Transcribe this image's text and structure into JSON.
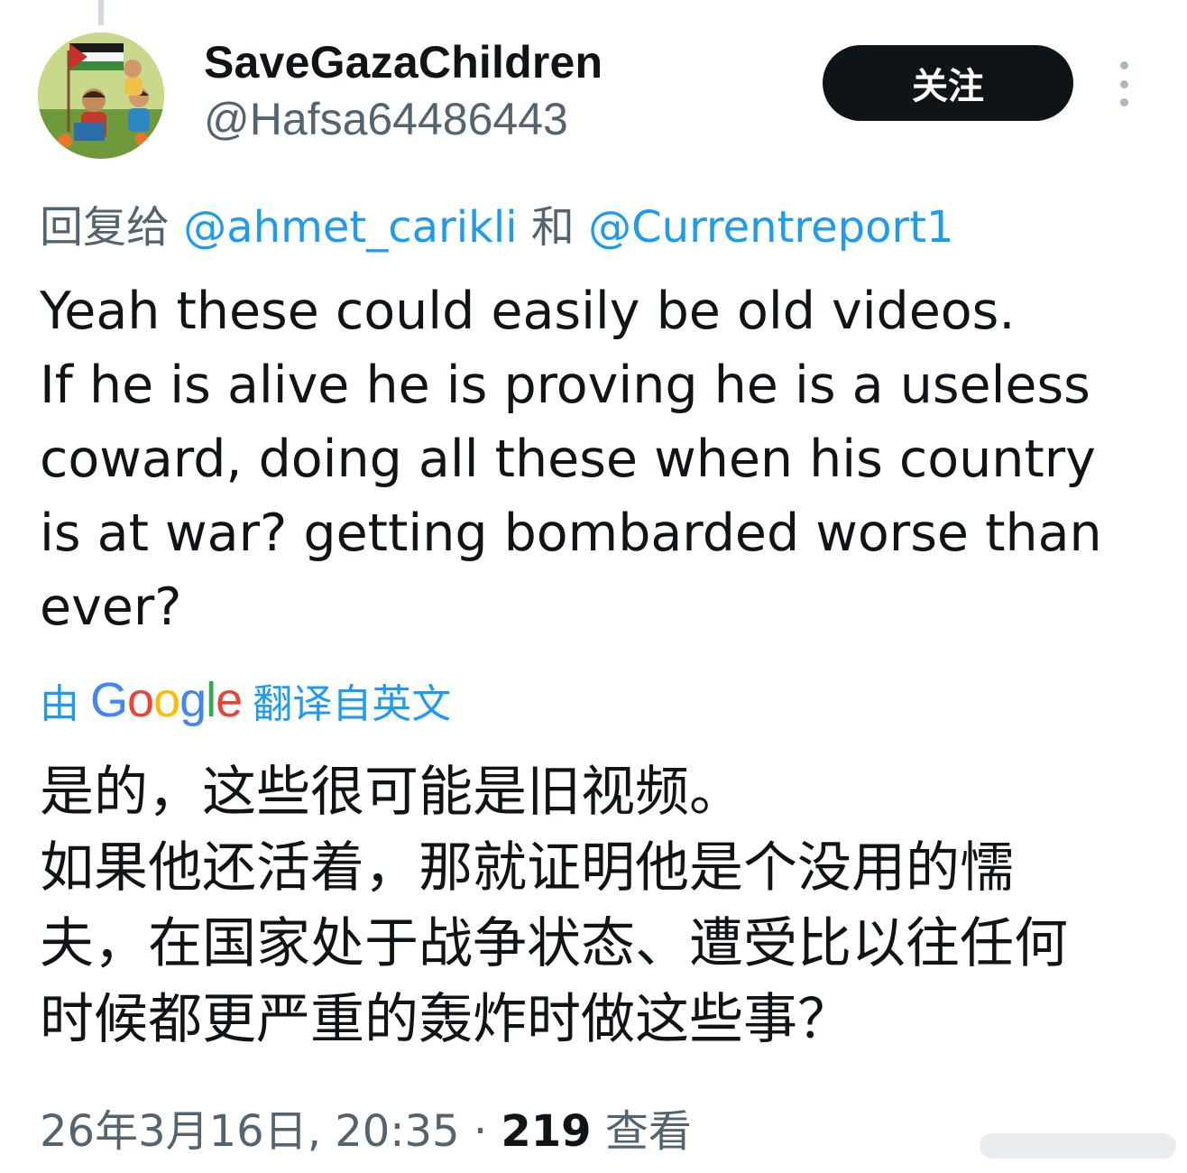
{
  "user": {
    "display_name": "SaveGazaChildren",
    "handle": "@Hafsa64486443",
    "avatar_icon": "profile-avatar-children-with-flag"
  },
  "actions": {
    "follow_label": "关注",
    "more_icon": "more-vertical-icon"
  },
  "reply": {
    "prefix": "回复给",
    "mention1": "@ahmet_carikli",
    "conjunction": "和",
    "mention2": "@Currentreport1"
  },
  "tweet": {
    "lines": [
      "Yeah these could easily be old videos.",
      "If he is alive he is proving he is a useless",
      "coward, doing all these when his country",
      "is at war? getting bombarded worse than",
      "ever?"
    ]
  },
  "translation": {
    "prefix": "由",
    "provider": "Google",
    "suffix": "翻译自英文",
    "lines": [
      "是的，这些很可能是旧视频。",
      "如果他还活着，那就证明他是个没用的懦",
      "夫，在国家处于战争状态、遭受比以往任何",
      "时候都更严重的轰炸时做这些事？"
    ]
  },
  "meta": {
    "timestamp": "26年3月16日, 20:35",
    "separator": "·",
    "views_count": "219",
    "views_label": "查看"
  },
  "colors": {
    "link": "#1d9bf0",
    "secondary_text": "#536471",
    "primary_text": "#0f1419",
    "button_bg": "#0f1419"
  }
}
